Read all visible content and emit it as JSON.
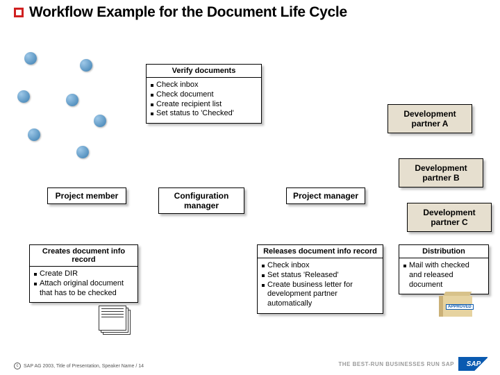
{
  "title": "Workflow Example for the Document Life Cycle",
  "verify": {
    "head": "Verify documents",
    "items": [
      "Check inbox",
      "Check document",
      "Create recipient list",
      "Set status to 'Checked'"
    ]
  },
  "roles": {
    "project_member": "Project member",
    "config_manager": "Configuration manager",
    "project_manager": "Project manager"
  },
  "partners": {
    "a": "Development partner A",
    "b": "Development partner B",
    "c": "Development partner C"
  },
  "creates": {
    "head": "Creates document info record",
    "items": [
      "Create DIR",
      "Attach original document that has to be checked"
    ]
  },
  "releases": {
    "head": "Releases document info record",
    "items": [
      "Check inbox",
      "Set status 'Released'",
      "Create business letter for development partner automatically"
    ]
  },
  "distribution": {
    "head": "Distribution",
    "items": [
      "Mail with checked and released document"
    ]
  },
  "package_label": "APPROVED",
  "footer": "SAP AG 2003, Title of Presentation, Speaker Name / 14",
  "brand": "THE BEST-RUN BUSINESSES RUN SAP",
  "logo": "SAP"
}
